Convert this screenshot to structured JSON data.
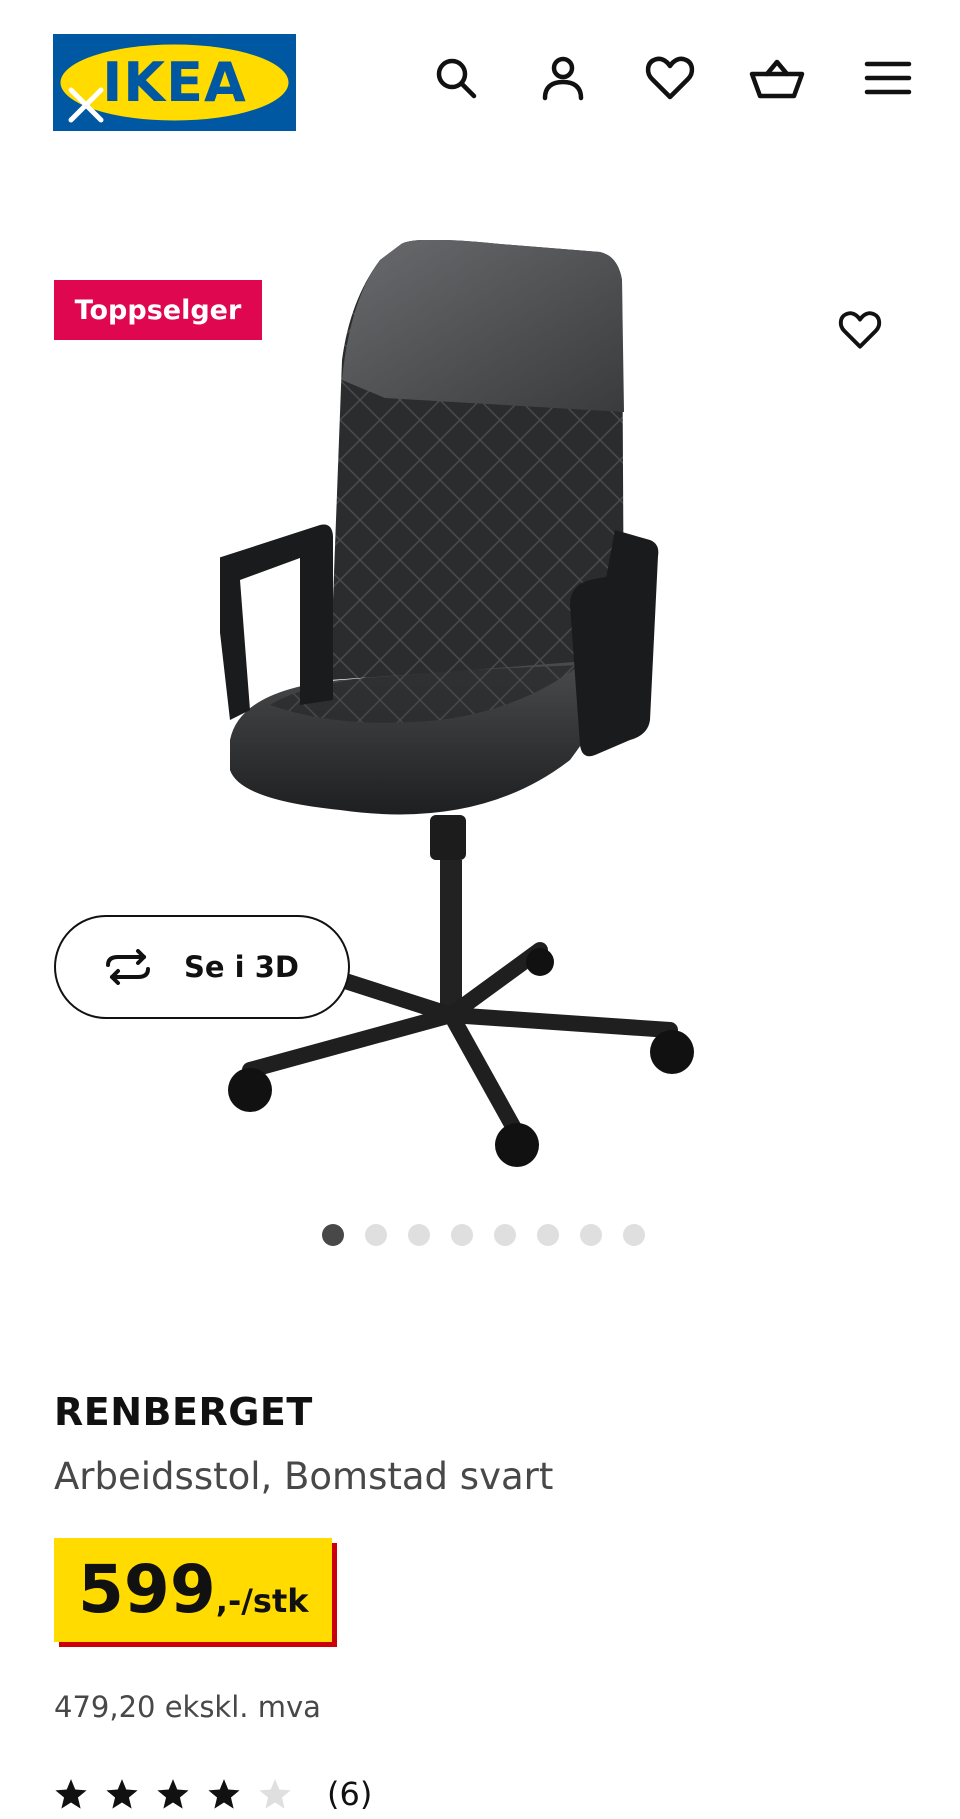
{
  "header": {
    "logo_text": "IKEA",
    "logo_colors": {
      "blue": "#0058a3",
      "yellow": "#ffdb00"
    },
    "icons": [
      "search-icon",
      "profile-icon",
      "heart-icon",
      "cart-icon",
      "menu-icon"
    ]
  },
  "gallery": {
    "badge": "Toppselger",
    "badge_color": "#e00751",
    "view_3d_label": "Se i 3D",
    "image_count": 8,
    "active_image": 1
  },
  "product": {
    "name": "RENBERGET",
    "description": "Arbeidsstol, Bomstad svart",
    "price": "599",
    "price_unit": ",-/stk",
    "price_ex_vat": "479,20 ekskl. mva",
    "rating": 4,
    "rating_max": 5,
    "review_count": "(6)"
  }
}
